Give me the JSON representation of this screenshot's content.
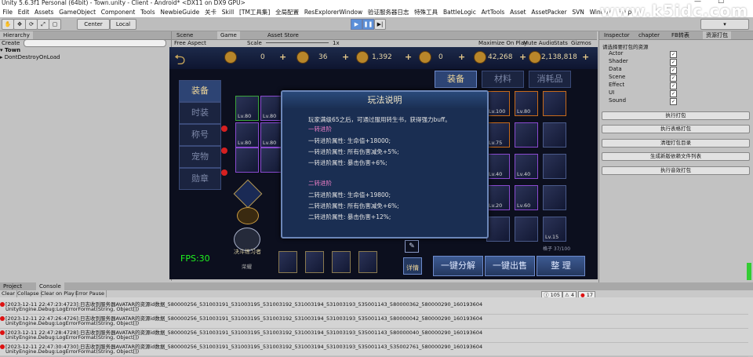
{
  "window": {
    "title": "Unity 5.6.3f1 Personal (64bit) - Town.unity - Client - Android* <DX11 on DX9 GPU>",
    "minimize": "—",
    "maximize": "☐"
  },
  "watermark": "www.k5idc.com",
  "menu": [
    "File",
    "Edit",
    "Assets",
    "GameObject",
    "Component",
    "Tools",
    "NewbieGuide",
    "关卡",
    "Skill",
    "[TM工具集]",
    "全局配置",
    "ResExplorerWindow",
    "验证服务器日志",
    "特殊工具",
    "BattleLogic",
    "ArtTools",
    "Asset",
    "AssetPacker",
    "SVN",
    "Window",
    "Help"
  ],
  "toolbar": {
    "pivot": "Center",
    "space": "Local"
  },
  "hierarchy": {
    "tab": "Hierarchy",
    "create": "Create",
    "search_placeholder": "All",
    "items": [
      "Town",
      "DontDestroyOnLoad"
    ]
  },
  "scene_tabs": [
    "Scene",
    "Game",
    "Asset Store"
  ],
  "game_bar": {
    "aspect": "Free Aspect",
    "scale_label": "Scale",
    "scale_value": "1x",
    "options": [
      "Maximize On Play",
      "Mute Audio",
      "Stats",
      "Gizmos"
    ]
  },
  "game": {
    "resources": [
      {
        "value": "0"
      },
      {
        "value": "36"
      },
      {
        "value": "1,392"
      },
      {
        "value": "0"
      },
      {
        "value": "42,268"
      },
      {
        "value": "2,138,818"
      }
    ],
    "top_tabs": [
      "装备",
      "材料",
      "消耗品"
    ],
    "side_buttons": [
      "装备",
      "时装",
      "称号",
      "宠物",
      "勋章"
    ],
    "fps": "FPS:30",
    "nickname": "决斗练习者",
    "rank": "荣耀",
    "grid_label": "格子 37/100",
    "detail": "详情",
    "buttons": [
      "一键分解",
      "一键出售",
      "整 理"
    ],
    "slot_levels": [
      "Lv.80",
      "Lv.80",
      "Lv.80",
      "Lv.80",
      "Lv.100",
      "Lv.80",
      "Lv.75",
      "Lv.40",
      "Lv.40",
      "Lv.20",
      "Lv.60",
      "Lv.15"
    ]
  },
  "dialog": {
    "title": "玩法说明",
    "intro": "玩家满级65之后，可通过服用转生书，获得强力buff。",
    "sec1": "一转进阶",
    "sec1_lines": [
      "一转进阶属性: 生命值+18000;",
      "一转进阶属性: 所有伤害减免+5%;",
      "一转进阶属性: 暴击伤害+6%;"
    ],
    "sec2": "二转进阶",
    "sec2_lines": [
      "二转进阶属性: 生命值+19800;",
      "二转进阶属性: 所有伤害减免+6%;",
      "二转进阶属性: 暴击伤害+12%;"
    ]
  },
  "inspector": {
    "tabs": [
      "Inspector",
      "chapter",
      "FB转表",
      "资源打包"
    ],
    "section": "请选择要打包的资源",
    "checks": [
      "Actor",
      "Shader",
      "Data",
      "Scene",
      "Effect",
      "UI",
      "Sound"
    ],
    "buttons": [
      "执行打包",
      "执行表格打包",
      "清理打包目录",
      "生成新版依赖文件列表",
      "执行音效打包"
    ]
  },
  "console": {
    "tabs": [
      "Project",
      "Console"
    ],
    "buttons": [
      "Clear",
      "Collapse",
      "Clear on Play",
      "Error Pause"
    ],
    "counts": {
      "info": "105",
      "warn": "4",
      "error": "17"
    },
    "logs": [
      {
        "l1": "[2023-12-11 22:47:23:4723]:日志收到服务器AVATAR的资源id数据_580000256_531003191_531003195_531003192_531003194_531003193_535001143_580000362_580000290_160193604",
        "l2": "UnityEngine.Debug:LogErrorFormat(String, Object[])"
      },
      {
        "l1": "[2023-12-11 22:47:26:4726]:日志收到服务器AVATAR的资源id数据_580000256_531003191_531003195_531003192_531003194_531003193_535001143_580000042_580000290_160193604",
        "l2": "UnityEngine.Debug:LogErrorFormat(String, Object[])"
      },
      {
        "l1": "[2023-12-11 22:47:28:4728]:日志收到服务器AVATAR的资源id数据_580000256_531003191_531003195_531003192_531003194_531003193_535001143_580000040_580000290_160193604",
        "l2": "UnityEngine.Debug:LogErrorFormat(String, Object[])"
      },
      {
        "l1": "[2023-12-11 22:47:30:4730]:日志收到服务器AVATAR的资源id数据_580000256_531003191_531003195_531003192_531003194_531003193_535001143_535002761_580000290_160193604",
        "l2": "UnityEngine.Debug:LogErrorFormat(String, Object[])"
      }
    ]
  },
  "colors": {
    "accent": "#5b8fd8",
    "dialog_bg": "#1a2e52",
    "fps": "#1ff51f",
    "error": "#d11111"
  }
}
